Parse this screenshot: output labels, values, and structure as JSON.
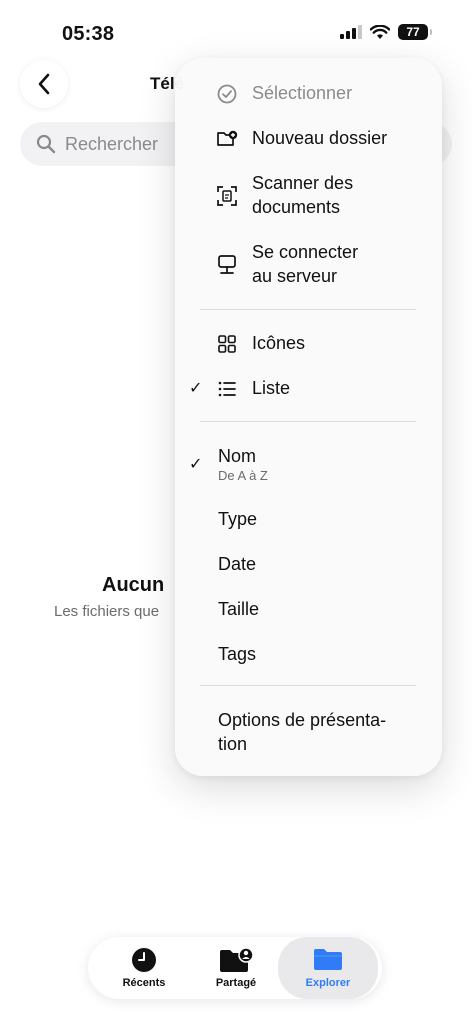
{
  "status_bar": {
    "time": "05:38",
    "battery": "77"
  },
  "header": {
    "title": "Télé"
  },
  "search": {
    "placeholder": "Rechercher"
  },
  "empty_state": {
    "title": "Aucun",
    "subtitle": "Les fichiers que"
  },
  "menu": {
    "select_label": "Sélectionner",
    "new_folder_label": "Nouveau dossier",
    "scan_line1": "Scanner des",
    "scan_line2": "documents",
    "connect_line1": "Se connecter",
    "connect_line2": "au serveur",
    "icons_label": "Icônes",
    "list_label": "Liste",
    "sort_name_label": "Nom",
    "sort_name_sub": "De A à Z",
    "sort_type_label": "Type",
    "sort_date_label": "Date",
    "sort_size_label": "Taille",
    "sort_tags_label": "Tags",
    "options_line1": "Options de présenta-",
    "options_line2": "tion",
    "check_glyph": "✓"
  },
  "tabbar": {
    "recents_label": "Récents",
    "shared_label": "Partagé",
    "browse_label": "Explorer"
  },
  "colors": {
    "accent": "#2f7cf6"
  }
}
